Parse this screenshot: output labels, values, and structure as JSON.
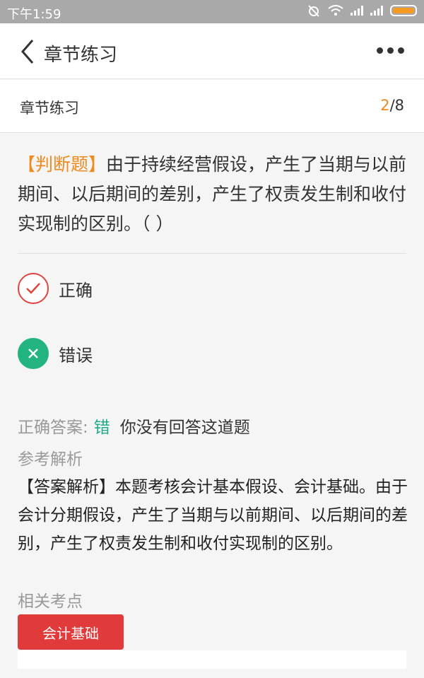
{
  "status_bar": {
    "time": "下午1:59"
  },
  "app_bar": {
    "title": "章节练习",
    "back_icon": "chevron-left-icon",
    "more_icon": "more-horizontal-icon"
  },
  "sub_header": {
    "title": "章节练习",
    "current_page": "2",
    "total_pages": "/8"
  },
  "question": {
    "type_label": "【判断题】",
    "text": "由于持续经营假设，产生了当期与以前期间、以后期间的差别，产生了权责发生制和收付实现制的区别。（    ）"
  },
  "options": [
    {
      "label": "正确",
      "icon": "check-circle-icon"
    },
    {
      "label": "错误",
      "icon": "x-circle-icon"
    }
  ],
  "result": {
    "correct_answer_label": "正确答案:",
    "correct_answer_value": "错",
    "status_text": "你没有回答这道题"
  },
  "analysis": {
    "title": "参考解析",
    "text": "【答案解析】本题考核会计基本假设、会计基础。由于会计分期假设，产生了当期与以前期间、以后期间的差别，产生了权责发生制和收付实现制的区别。"
  },
  "related": {
    "title": "相关考点",
    "tags": [
      "会计基础"
    ]
  },
  "colors": {
    "accent_orange": "#f08a1e",
    "correct_red": "#e0443f",
    "wrong_green": "#21b47e",
    "tag_red": "#e03a3a"
  }
}
